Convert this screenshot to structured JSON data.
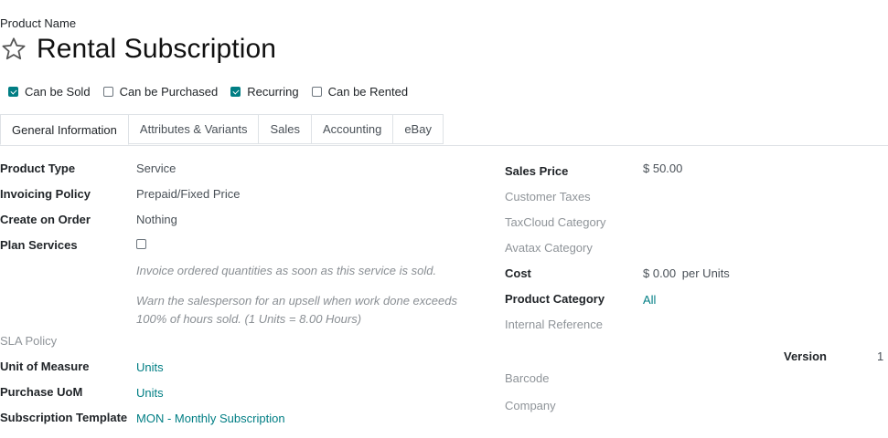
{
  "form": {
    "name_label": "Product Name",
    "title": "Rental Subscription",
    "star_icon": "star-outline-icon"
  },
  "options": [
    {
      "label": "Can be Sold",
      "checked": true
    },
    {
      "label": "Can be Purchased",
      "checked": false
    },
    {
      "label": "Recurring",
      "checked": true
    },
    {
      "label": "Can be Rented",
      "checked": false
    }
  ],
  "tabs": [
    {
      "label": "General Information",
      "active": true
    },
    {
      "label": "Attributes & Variants",
      "active": false
    },
    {
      "label": "Sales",
      "active": false
    },
    {
      "label": "Accounting",
      "active": false
    },
    {
      "label": "eBay",
      "active": false
    }
  ],
  "left": {
    "product_type": {
      "label": "Product Type",
      "value": "Service"
    },
    "invoicing_policy": {
      "label": "Invoicing Policy",
      "value": "Prepaid/Fixed Price"
    },
    "create_on_order": {
      "label": "Create on Order",
      "value": "Nothing"
    },
    "plan_services": {
      "label": "Plan Services",
      "checked": false
    },
    "note1": "Invoice ordered quantities as soon as this service is sold.",
    "note2_line1": "Warn the salesperson for an upsell when work done exceeds",
    "note2_line2": "100% of hours sold. (1 Units = 8.00 Hours)",
    "sla_policy": {
      "label": "SLA Policy"
    },
    "unit_of_measure": {
      "label": "Unit of Measure",
      "value": "Units"
    },
    "purchase_uom": {
      "label": "Purchase UoM",
      "value": "Units"
    },
    "subscription_template": {
      "label": "Subscription Template",
      "value": "MON - Monthly Subscription"
    }
  },
  "right": {
    "sales_price": {
      "label": "Sales Price",
      "value": "$ 50.00"
    },
    "customer_taxes": {
      "label": "Customer Taxes"
    },
    "taxcloud_category": {
      "label": "TaxCloud Category"
    },
    "avatax_category": {
      "label": "Avatax Category"
    },
    "cost": {
      "label": "Cost",
      "value": "$ 0.00",
      "unit": "per Units"
    },
    "product_category": {
      "label": "Product Category",
      "value": "All"
    },
    "internal_reference": {
      "label": "Internal Reference"
    },
    "version": {
      "label": "Version",
      "value": "1"
    },
    "barcode": {
      "label": "Barcode"
    },
    "company": {
      "label": "Company"
    }
  },
  "colors": {
    "accent": "#017e84",
    "muted": "#8f9499"
  }
}
